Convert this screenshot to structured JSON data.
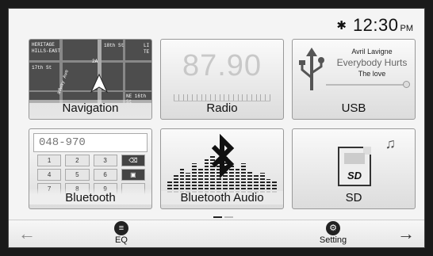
{
  "status": {
    "bluetooth_icon": "bluetooth-icon",
    "time": "12:30",
    "ampm": "PM"
  },
  "tiles": {
    "navigation": {
      "label": "Navigation",
      "map_labels": [
        "HERITAGE",
        "HILLS-EAST",
        "17th St",
        "18th St",
        "adway Ave",
        "NE 16th St",
        "2A",
        "LI",
        "TE"
      ]
    },
    "radio": {
      "label": "Radio",
      "frequency": "87.90"
    },
    "usb": {
      "label": "USB",
      "artist": "Avril Lavigne",
      "song": "Everybody Hurts",
      "album": "The love"
    },
    "bluetooth": {
      "label": "Bluetooth",
      "dialed_number": "048-970",
      "keys": [
        "1",
        "2",
        "3",
        "⌫",
        "4",
        "5",
        "6",
        "▣",
        "7",
        "8",
        "9",
        ""
      ]
    },
    "bluetooth_audio": {
      "label": "Bluetooth Audio"
    },
    "sd": {
      "label": "SD",
      "card_logo": "SD"
    }
  },
  "pager": {
    "pages": 2,
    "current": 1
  },
  "bottom_bar": {
    "back_arrow": "←",
    "forward_arrow": "→",
    "eq_label": "EQ",
    "setting_label": "Setting"
  }
}
